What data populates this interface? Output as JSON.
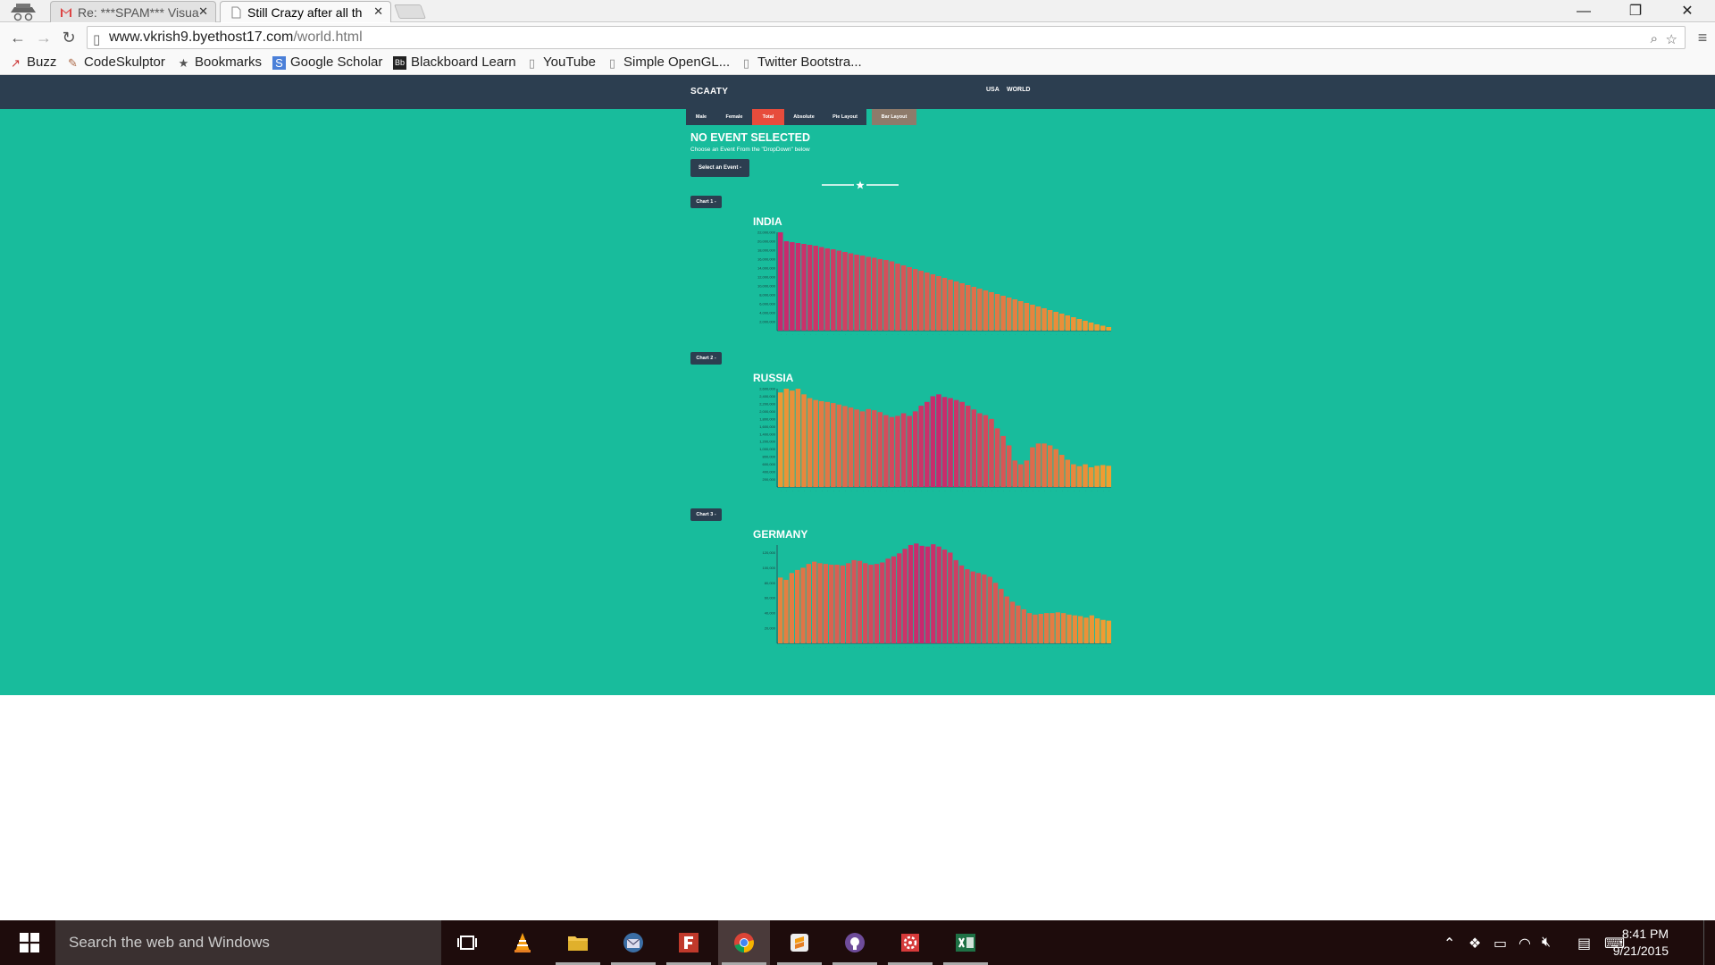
{
  "browser": {
    "tabs": [
      {
        "title": "Re: ***SPAM*** Visua",
        "icon": "gmail-icon",
        "active": false
      },
      {
        "title": "Still Crazy after all th",
        "icon": "page-icon",
        "active": true
      }
    ],
    "url_host": "www.vkrish9.byethost17.com",
    "url_path": "/world.html",
    "bookmarks": [
      {
        "label": "Buzz",
        "icon": "buzz-icon"
      },
      {
        "label": "CodeSkulptor",
        "icon": "pencil-icon"
      },
      {
        "label": "Bookmarks",
        "icon": "star-icon"
      },
      {
        "label": "Google Scholar",
        "icon": "scholar-icon"
      },
      {
        "label": "Blackboard Learn",
        "icon": "blackboard-icon"
      },
      {
        "label": "YouTube",
        "icon": "page-icon"
      },
      {
        "label": "Simple OpenGL...",
        "icon": "page-icon"
      },
      {
        "label": "Twitter Bootstra...",
        "icon": "page-icon"
      }
    ]
  },
  "site": {
    "brand": "SCAATY",
    "nav": [
      "USA",
      "WORLD"
    ],
    "buttons": [
      {
        "label": "Male",
        "color": "#2c3e50"
      },
      {
        "label": "Female",
        "color": "#2c3e50"
      },
      {
        "label": "Total",
        "color": "#e74c3c"
      },
      {
        "label": "Absolute",
        "color": "#2c3e50"
      },
      {
        "label": "Pie Layout",
        "color": "#2c3e50"
      },
      {
        "label": "Bar Layout",
        "color": "#8e7b6b"
      }
    ],
    "heading": "NO EVENT SELECTED",
    "subheading": "Choose an Event From the \"DropDown\" below",
    "select_button": "Select an Event -",
    "chart_buttons": [
      "Chart 1 -",
      "Chart 2 -",
      "Chart 3 -"
    ],
    "colors": {
      "navbar": "#2c3e50",
      "background": "#18bc9c",
      "bar_start": "#c8286e",
      "bar_end": "#f0a030"
    }
  },
  "chart_data": [
    {
      "type": "bar",
      "title": "INDIA",
      "ylim": [
        0,
        22000000
      ],
      "yticks": [
        "2,000,000",
        "4,000,000",
        "6,000,000",
        "8,000,000",
        "10,000,000",
        "12,000,000",
        "14,000,000",
        "16,000,000",
        "18,000,000",
        "20,000,000",
        "22,000,000"
      ],
      "values": [
        22000000,
        20000000,
        19800000,
        19600000,
        19400000,
        19200000,
        19000000,
        18700000,
        18400000,
        18200000,
        17900000,
        17600000,
        17300000,
        17000000,
        16800000,
        16500000,
        16300000,
        16000000,
        15800000,
        15500000,
        15000000,
        14600000,
        14200000,
        13800000,
        13400000,
        13000000,
        12600000,
        12200000,
        11800000,
        11400000,
        11000000,
        10600000,
        10200000,
        9800000,
        9400000,
        9000000,
        8600000,
        8200000,
        7800000,
        7400000,
        7000000,
        6600000,
        6200000,
        5800000,
        5400000,
        5000000,
        4600000,
        4200000,
        3800000,
        3400000,
        3000000,
        2600000,
        2200000,
        1800000,
        1400000,
        1100000,
        800000
      ],
      "bar_color_peak_index": 0
    },
    {
      "type": "bar",
      "title": "RUSSIA",
      "ylim": [
        0,
        2600000
      ],
      "yticks": [
        "200,000",
        "400,000",
        "600,000",
        "800,000",
        "1,000,000",
        "1,200,000",
        "1,400,000",
        "1,600,000",
        "1,800,000",
        "2,000,000",
        "2,200,000",
        "2,400,000",
        "2,600,000"
      ],
      "values": [
        2500000,
        2600000,
        2550000,
        2600000,
        2450000,
        2350000,
        2300000,
        2270000,
        2250000,
        2220000,
        2180000,
        2140000,
        2100000,
        2050000,
        2000000,
        2060000,
        2030000,
        1980000,
        1900000,
        1850000,
        1880000,
        1950000,
        1880000,
        2000000,
        2150000,
        2250000,
        2400000,
        2450000,
        2380000,
        2350000,
        2300000,
        2250000,
        2150000,
        2050000,
        1950000,
        1900000,
        1800000,
        1550000,
        1350000,
        1100000,
        700000,
        600000,
        700000,
        1050000,
        1150000,
        1150000,
        1100000,
        1000000,
        850000,
        720000,
        600000,
        550000,
        600000,
        520000,
        560000,
        580000,
        560000
      ],
      "bar_color_peak_index": 27
    },
    {
      "type": "bar",
      "title": "GERMANY",
      "ylim": [
        0,
        130000
      ],
      "yticks": [
        "20,000",
        "40,000",
        "60,000",
        "80,000",
        "100,000",
        "120,000"
      ],
      "values": [
        87000,
        84000,
        93000,
        97000,
        100000,
        105000,
        108000,
        106000,
        105000,
        104000,
        104000,
        103000,
        106000,
        110000,
        109000,
        106000,
        104000,
        105000,
        107000,
        112000,
        115000,
        119000,
        125000,
        130000,
        132000,
        129000,
        128000,
        131000,
        128000,
        124000,
        120000,
        110000,
        103000,
        98000,
        95000,
        93000,
        91000,
        88000,
        80000,
        72000,
        62000,
        55000,
        50000,
        45000,
        40000,
        38000,
        39000,
        40000,
        40000,
        41000,
        40000,
        38000,
        37000,
        36000,
        34000,
        37000,
        33000,
        31000,
        30000
      ],
      "bar_color_peak_index": 25
    }
  ],
  "taskbar": {
    "search_placeholder": "Search the web and Windows",
    "time": "8:41 PM",
    "date": "9/21/2015"
  }
}
